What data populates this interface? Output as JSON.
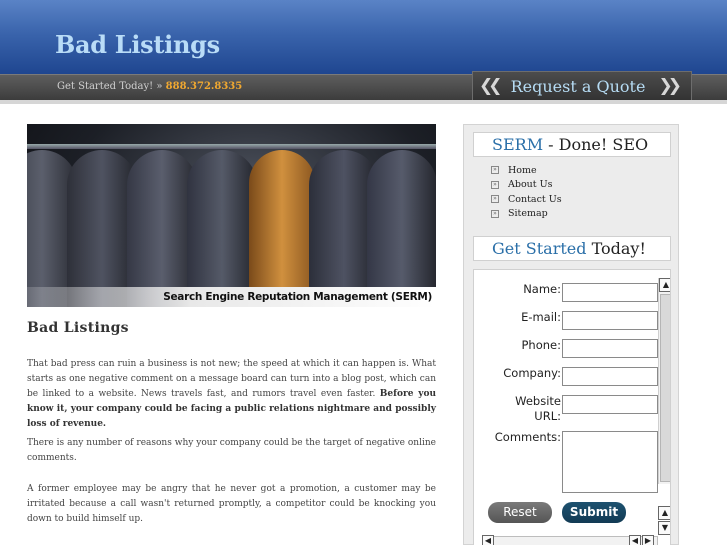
{
  "header": {
    "site_title": "Bad Listings",
    "tagline_prefix": "Get Started Today! »",
    "phone": "888.372.8335",
    "quote_button": "Request a Quote"
  },
  "hero": {
    "caption": "Search Engine Reputation Management (SERM)"
  },
  "main": {
    "heading": "Bad Listings",
    "p1_normal": "That bad press can ruin a business is not new; the speed at which it can happen is. What starts as one negative comment on a message board can turn into a blog post, which can be linked to a website. News travels fast, and rumors travel even faster. ",
    "p1_bold": "Before you know it, your company could be facing a public relations nightmare and possibly loss of revenue.",
    "p2": "There is any number of reasons why your company could be the target of negative online comments.",
    "p3": "A former employee may be angry that he never got a promotion, a customer may be irritated because a call wasn't returned promptly, a competitor could be knocking you down to build himself up."
  },
  "sidebar": {
    "serm_title_accent": "SERM",
    "serm_title_rest": " - Done! SEO",
    "nav": [
      {
        "label": "Home"
      },
      {
        "label": "About Us"
      },
      {
        "label": "Contact Us"
      },
      {
        "label": "Sitemap"
      }
    ],
    "started_title_accent": "Get Started",
    "started_title_rest": " Today!",
    "form": {
      "name_label": "Name:",
      "email_label": "E-mail:",
      "phone_label": "Phone:",
      "company_label": "Company:",
      "website_label": "Website URL:",
      "comments_label": "Comments:",
      "reset_label": "Reset",
      "submit_label": "Submit"
    }
  }
}
